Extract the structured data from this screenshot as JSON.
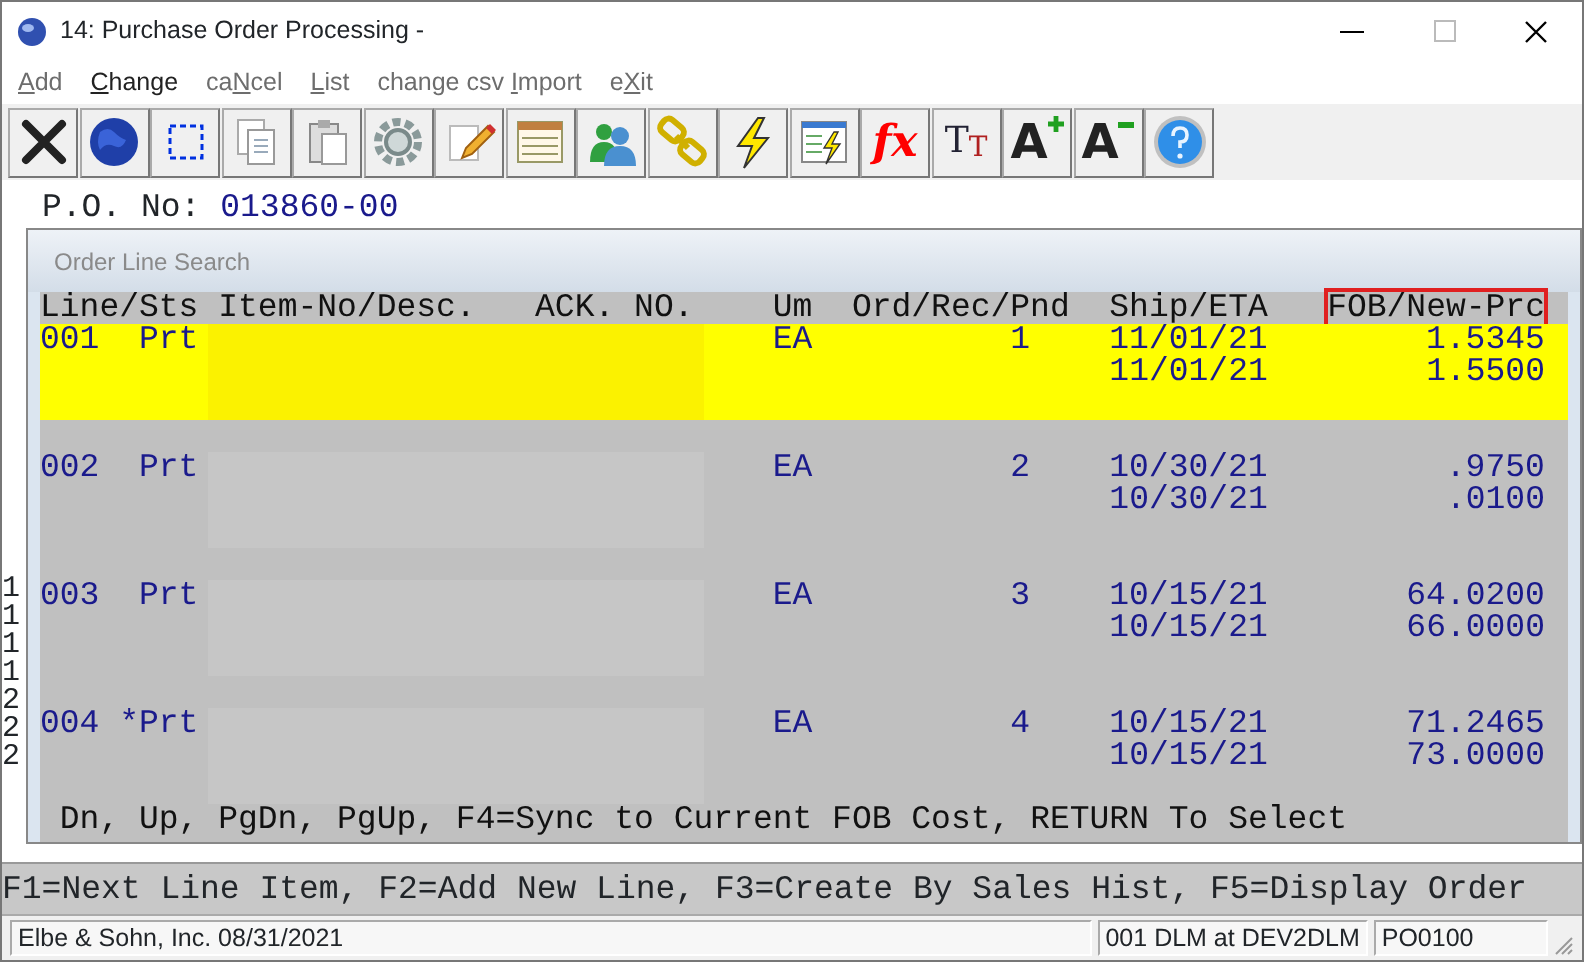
{
  "window": {
    "title": "14: Purchase Order Processing -"
  },
  "menu": [
    {
      "key": "A",
      "post": "dd",
      "disabled": true
    },
    {
      "key": "C",
      "post": "hange",
      "disabled": false
    },
    {
      "pre": "ca",
      "key": "N",
      "post": "cel",
      "disabled": true
    },
    {
      "key": "L",
      "post": "ist",
      "disabled": true
    },
    {
      "pre": "change csv ",
      "key": "I",
      "post": "mport",
      "disabled": true
    },
    {
      "pre": "e",
      "key": "X",
      "post": "it",
      "disabled": true
    }
  ],
  "toolbar": [
    {
      "kind": "close"
    },
    {
      "kind": "globe"
    },
    {
      "kind": "select"
    },
    {
      "kind": "copy"
    },
    {
      "kind": "paste"
    },
    {
      "kind": "gear"
    },
    {
      "kind": "pencil"
    },
    {
      "kind": "form"
    },
    {
      "kind": "users"
    },
    {
      "kind": "chain"
    },
    {
      "kind": "bolt"
    },
    {
      "kind": "boltdoc"
    },
    {
      "kind": "fx",
      "glyph": "fx"
    },
    {
      "kind": "tt",
      "glyph": "T",
      "glyph2": "T"
    },
    {
      "kind": "aplus",
      "glyph": "A"
    },
    {
      "kind": "aminus",
      "glyph": "A"
    },
    {
      "kind": "help"
    }
  ],
  "terminal": {
    "po_label": "P.O. No:",
    "po_value": "013860-00",
    "left_edge": [
      "1",
      "1",
      "1",
      "1",
      "2",
      "2",
      "2"
    ]
  },
  "dialog": {
    "title": "Order Line Search",
    "columns": [
      {
        "label": "Line/Sts",
        "highlighted": false
      },
      {
        "label": "Item-No/Desc.",
        "highlighted": false
      },
      {
        "label": "ACK. NO.",
        "highlighted": false
      },
      {
        "label": "Um",
        "highlighted": false
      },
      {
        "label": "Ord/Rec/Pnd",
        "highlighted": false
      },
      {
        "label": "Ship/ETA",
        "highlighted": false
      },
      {
        "label": "FOB/New-Prc",
        "highlighted": true
      }
    ],
    "rows": [
      {
        "line": "001",
        "status": "Prt",
        "um": "EA",
        "qty": "1",
        "ship": [
          "11/01/21",
          "11/01/21"
        ],
        "price": [
          "1.5345",
          "1.5500"
        ],
        "selected": true
      },
      {
        "line": "002",
        "status": "Prt",
        "um": "EA",
        "qty": "2",
        "ship": [
          "10/30/21",
          "10/30/21"
        ],
        "price": [
          ".9750",
          ".0100"
        ],
        "selected": false
      },
      {
        "line": "003",
        "status": "Prt",
        "um": "EA",
        "qty": "3",
        "ship": [
          "10/15/21",
          "10/15/21"
        ],
        "price": [
          "64.0200",
          "66.0000"
        ],
        "selected": false
      },
      {
        "line": "004",
        "status": "*Prt",
        "um": "EA",
        "qty": "4",
        "ship": [
          "10/15/21",
          "10/15/21"
        ],
        "price": [
          "71.2465",
          "73.0000"
        ],
        "selected": false
      }
    ],
    "prompt": "Dn, Up, PgDn, PgUp, F4=Sync to Current FOB Cost, RETURN To Select"
  },
  "function_keys": "F1=Next Line Item, F2=Add New Line, F3=Create By Sales Hist, F5=Display Order",
  "status_bar": [
    "Elbe & Sohn, Inc. 08/31/2021",
    "001 DLM at DEV2DLM",
    "PO0100"
  ]
}
